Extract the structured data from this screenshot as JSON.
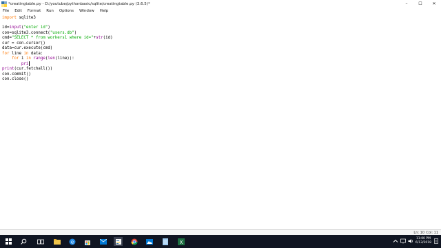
{
  "window": {
    "title": "*creatingtable.py - D:/youtube/pythonbasic/sqlite/creatingtable.py (3.6.5)*",
    "controls": {
      "minimize": "–",
      "maximize": "☐",
      "close": "✕"
    }
  },
  "menu": {
    "file": "File",
    "edit": "Edit",
    "format": "Format",
    "run": "Run",
    "options": "Options",
    "window": "Window",
    "help": "Help"
  },
  "code": {
    "l1_kw": "import",
    "l1_rest": " sqlite3",
    "l2_a": "id=",
    "l2_bi": "input",
    "l2_b": "(",
    "l2_str": "\"enter id\"",
    "l2_c": ")",
    "l3_a": "con=sqlite3.connect(",
    "l3_str": "\"users.db\"",
    "l3_c": ")",
    "l4_a": "cmd=",
    "l4_str": "\"SELECT * from workers1 where id=\"",
    "l4_b": "+",
    "l4_bi": "str",
    "l4_c": "(id)",
    "l5": "cur = con.cursor()",
    "l6": "data=cur.execute(cmd)",
    "l7_kw1": "for",
    "l7_a": " line ",
    "l7_kw2": "in",
    "l7_b": " data:",
    "l8_indent": "    ",
    "l8_kw1": "for",
    "l8_a": " i ",
    "l8_kw2": "in",
    "l8_b": " ",
    "l8_bi1": "range",
    "l8_c": "(",
    "l8_bi2": "len",
    "l8_d": "(line)):",
    "l9_indent": "        ",
    "l9_bi": "pri",
    "l10_bi": "print",
    "l10_rest": "(cur.fetchall())",
    "l11": "con.commit()",
    "l12": "con.close()"
  },
  "status": {
    "line": "Ln: 10",
    "col": "Col: 11"
  },
  "taskbar": {
    "time": "11:00 PM",
    "date": "6/13/2018",
    "icons": [
      "windows-start-icon",
      "search-icon",
      "task-view-icon",
      "file-explorer-icon",
      "edge-icon",
      "store-icon",
      "mail-icon",
      "idle-icon",
      "chrome-icon",
      "photos-icon",
      "notepad-icon",
      "excel-icon"
    ]
  },
  "colors": {
    "keyword": "#ff7700",
    "string": "#00aa00",
    "builtin": "#900090",
    "taskbar": "#101522"
  }
}
